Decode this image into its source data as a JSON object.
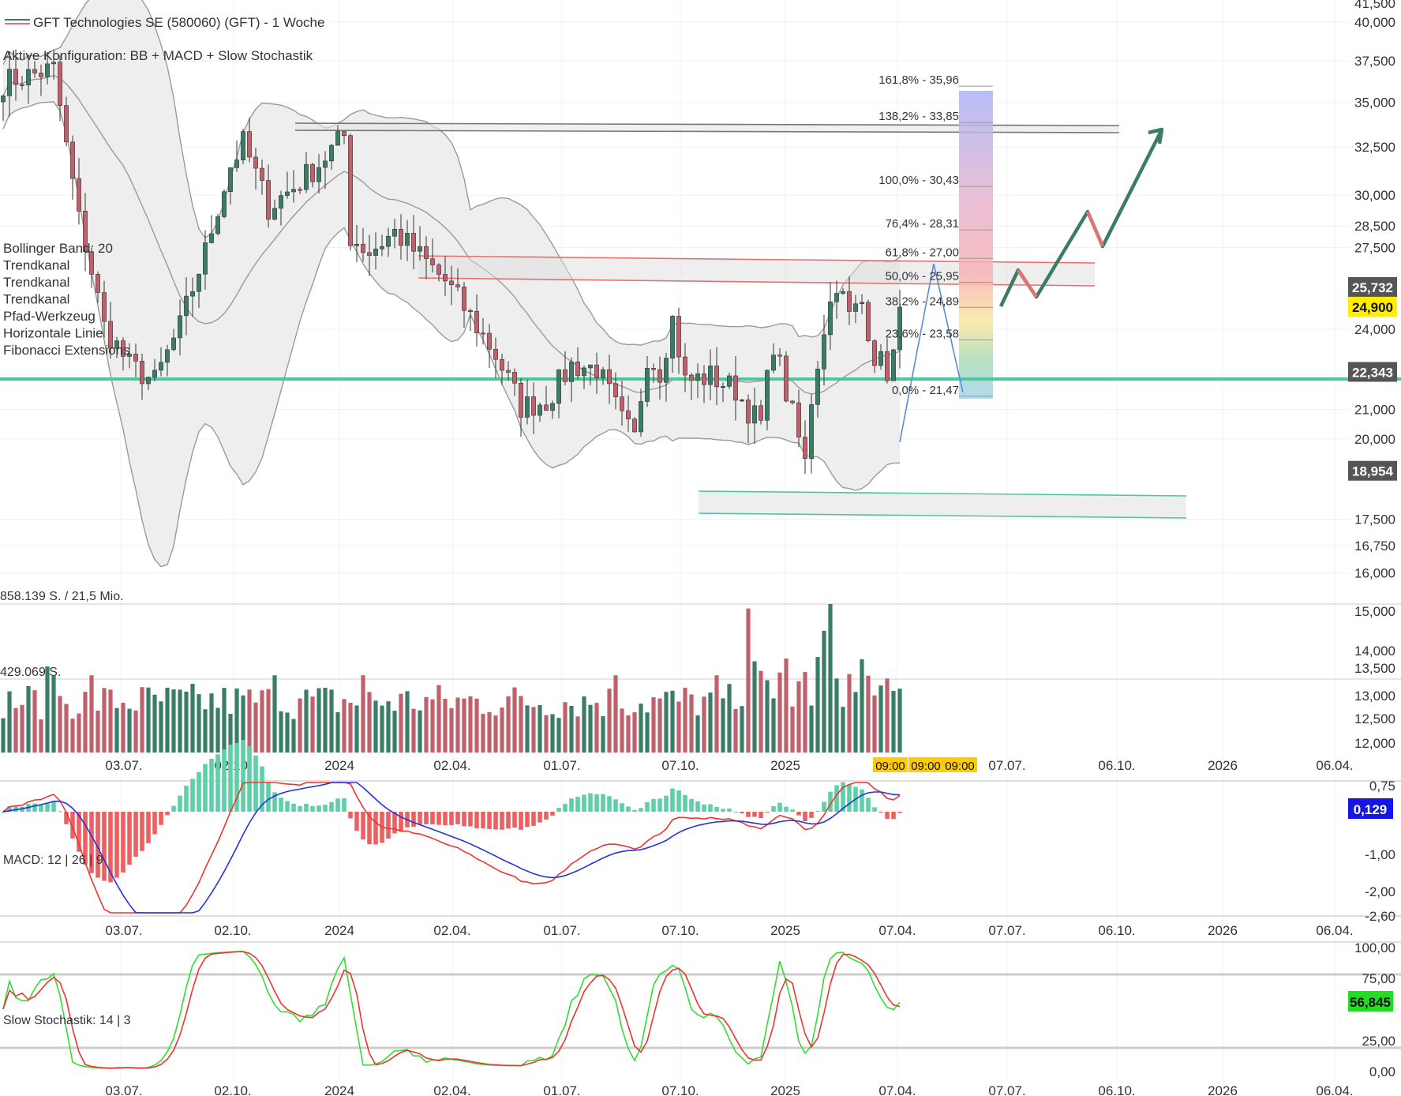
{
  "header": {
    "title": "GFT Technologies SE (580060) (GFT) - 1 Woche",
    "config": "Aktive Konfiguration: BB + MACD + Slow Stochastik"
  },
  "overlay_list": [
    {
      "label": "Bollinger Band: 20",
      "color": "#777777"
    },
    {
      "label": "Trendkanal",
      "color": "#3cc9a0"
    },
    {
      "label": "Trendkanal",
      "color": "#e85a5a"
    },
    {
      "label": "Trendkanal",
      "color": "#777777"
    },
    {
      "label": "Pfad-Werkzeug",
      "color": "#777777"
    },
    {
      "label": "Horizontale Linie",
      "color": "#3cc9a0"
    },
    {
      "label": "Fibonacci Extensions",
      "color": "#777777"
    }
  ],
  "colors": {
    "up": "#3a7d66",
    "down": "#c0606a",
    "bb_fill": "#eeeeee",
    "hline": "#4cc89a",
    "macd_line": "#ee3333",
    "signal_line": "#2233dd",
    "stoch_k": "#33dd33",
    "stoch_d": "#ee3333"
  },
  "x_axis_labels": [
    "03.07.",
    "02.10.",
    "2024",
    "02.04.",
    "01.07.",
    "07.10.",
    "2025",
    "07.04.",
    "07.07.",
    "06.10.",
    "2026",
    "06.04."
  ],
  "volume_axis_labels": [
    "03.07.",
    "02.10.",
    "2024",
    "02.04.",
    "01.07.",
    "07.10.",
    "2025",
    "07.07.",
    "06.10.",
    "2026",
    "06.04."
  ],
  "price_axis": [
    "41,500",
    "40,000",
    "37,500",
    "35,000",
    "32,500",
    "30,000",
    "28,500",
    "27,500",
    "24,000",
    "21,000",
    "20,000",
    "17,500",
    "16,750",
    "16,000",
    "15,000",
    "14,000",
    "13,500",
    "13,000",
    "12,500",
    "12,000"
  ],
  "price_badges": [
    {
      "value": "25,732",
      "bg": "#555555",
      "fg": "#ffffff"
    },
    {
      "value": "24,900",
      "bg": "#ffee00",
      "fg": "#111111"
    },
    {
      "value": "22,343",
      "bg": "#555555",
      "fg": "#ffffff"
    },
    {
      "value": "18,954",
      "bg": "#555555",
      "fg": "#ffffff"
    }
  ],
  "fib_levels": [
    "161,8% - 35,96",
    "138,2% - 33,85",
    "100,0% - 30,43",
    "76,4% - 28,31",
    "61,8% - 27,00",
    "50,0% - 25,95",
    "38,2% - 24,89",
    "23,6% - 23,58",
    "0,0% - 21,47"
  ],
  "volume": {
    "label_top": "858.139 S. / 21,5 Mio.",
    "label_mid": "429.069 S.",
    "time_tags": [
      "09:00",
      "09:00",
      "09:00"
    ]
  },
  "macd": {
    "label": "MACD: 12 | 26 | 9",
    "axis": [
      "0,75",
      "-1,00",
      "-2,00",
      "-2,60"
    ],
    "badge": "0,129"
  },
  "stoch": {
    "label": "Slow Stochastik: 14 | 3",
    "axis": [
      "100,00",
      "75,00",
      "25,00",
      "0,00"
    ],
    "badge": "56,845"
  },
  "chart_data": {
    "type": "candlestick",
    "title": "GFT Technologies SE (580060) (GFT) - 1 Woche",
    "y_range": [
      15.6,
      41.5
    ],
    "close_path": [
      [
        0,
        36.2
      ],
      [
        8,
        37.0
      ],
      [
        10,
        32.5
      ],
      [
        12,
        28.8
      ],
      [
        16,
        24.1
      ],
      [
        20,
        22.6
      ],
      [
        24,
        22.0
      ],
      [
        28,
        24.1
      ],
      [
        32,
        27.3
      ],
      [
        36,
        31.5
      ],
      [
        38,
        32.7
      ],
      [
        42,
        29.4
      ],
      [
        46,
        30.4
      ],
      [
        50,
        31.6
      ],
      [
        54,
        33.1
      ],
      [
        55,
        28.0
      ],
      [
        58,
        27.3
      ],
      [
        62,
        28.2
      ],
      [
        66,
        27.1
      ],
      [
        70,
        26.0
      ],
      [
        74,
        24.5
      ],
      [
        78,
        23.0
      ],
      [
        82,
        21.1
      ],
      [
        86,
        21.3
      ],
      [
        90,
        22.6
      ],
      [
        94,
        22.5
      ],
      [
        98,
        20.6
      ],
      [
        100,
        20.0
      ],
      [
        102,
        23.0
      ],
      [
        104,
        22.4
      ],
      [
        106,
        24.4
      ],
      [
        108,
        22.0
      ],
      [
        112,
        22.2
      ],
      [
        116,
        21.7
      ],
      [
        118,
        21.0
      ],
      [
        120,
        20.5
      ],
      [
        122,
        23.5
      ],
      [
        124,
        21.6
      ],
      [
        126,
        20.0
      ],
      [
        127,
        19.2
      ],
      [
        128,
        21.4
      ],
      [
        130,
        24.1
      ],
      [
        132,
        26.0
      ],
      [
        134,
        24.5
      ],
      [
        136,
        25.1
      ],
      [
        138,
        23.0
      ],
      [
        140,
        22.4
      ],
      [
        141,
        23.0
      ],
      [
        142,
        24.9
      ]
    ],
    "volume_scale_max_shares": 858139,
    "macd_range": [
      -2.6,
      0.75
    ],
    "stoch_range": [
      0,
      100
    ],
    "stoch_bands": [
      20,
      80
    ]
  }
}
